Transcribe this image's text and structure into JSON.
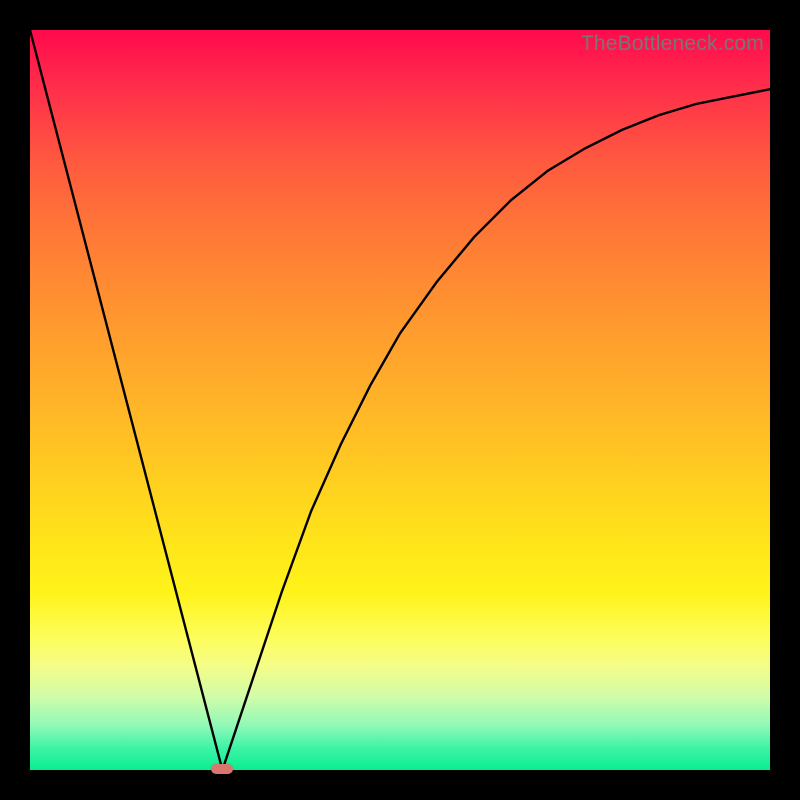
{
  "watermark": "TheBottleneck.com",
  "colors": {
    "frame": "#000000",
    "curve": "#000000",
    "marker": "#db766f"
  },
  "chart_data": {
    "type": "line",
    "title": "",
    "xlabel": "",
    "ylabel": "",
    "xlim": [
      0,
      100
    ],
    "ylim": [
      0,
      100
    ],
    "grid": false,
    "legend": false,
    "series": [
      {
        "name": "left-segment",
        "x": [
          0,
          26
        ],
        "values": [
          100,
          0
        ]
      },
      {
        "name": "right-segment",
        "x": [
          26,
          30,
          34,
          38,
          42,
          46,
          50,
          55,
          60,
          65,
          70,
          75,
          80,
          85,
          90,
          95,
          100
        ],
        "values": [
          0,
          12,
          24,
          35,
          44,
          52,
          59,
          66,
          72,
          77,
          81,
          84,
          86.5,
          88.5,
          90,
          91,
          92
        ]
      }
    ],
    "marker": {
      "x": 26,
      "y": 0
    },
    "background_gradient": {
      "top": "#ff0a4d",
      "middle": "#ffe61a",
      "bottom": "#0aee8f"
    }
  }
}
